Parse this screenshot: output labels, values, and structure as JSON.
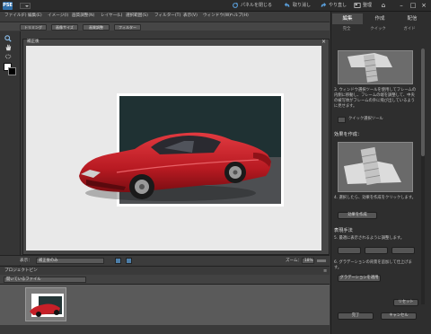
{
  "app": {
    "logo": "PSE"
  },
  "topbar": {
    "panel_toggle": "パネルを閉じる",
    "undo": "取り消し",
    "redo": "やり直し",
    "organizer": "整理"
  },
  "menu": [
    "ファイル(F)",
    "編集(E)",
    "イメージ(I)",
    "画質調整(N)",
    "レイヤー(L)",
    "選択範囲(S)",
    "フィルター(T)",
    "表示(V)",
    "ウィンドウ(W)",
    "ヘルプ(H)"
  ],
  "options": [
    "トリミング",
    "画像サイズ",
    "画質調整",
    "フィルター"
  ],
  "document": {
    "tab_label": "補正後",
    "close": "×"
  },
  "status": {
    "view_label": "表示：",
    "view_value": "補正後のみ",
    "zoom_label": "ズーム：",
    "zoom_value": "18%"
  },
  "bin": {
    "header": "プロジェクトビン",
    "dropdown": "開いているファイル"
  },
  "panel": {
    "tabs": [
      "編集",
      "作成",
      "配信"
    ],
    "subtabs": [
      "完全",
      "クイック",
      "ガイド"
    ],
    "step3_text": "3. ウィンドウ選択ツールを使用してフレームの内側に移動し、フレームの端を調整して、中央の被写体がフレームの外に飛び出しているように見せます。",
    "quick_tool": "クイック選択ツール",
    "effect_heading": "効果を作成：",
    "step4_text": "4. 選択したら、効果を作成をクリックします。",
    "create_effect_btn": "効果を作成",
    "finish_heading": "表現手法",
    "step5_text": "5. 最適に表示されるように調整します。",
    "style_buttons": [
      "",
      "",
      ""
    ],
    "step6_text": "6. グラデーションの背景を追加して仕上げます。",
    "gradient_btn": "グラデーションを適用",
    "reset_btn": "リセット",
    "done_btn": "完了",
    "cancel_btn": "キャンセル"
  },
  "colors": {
    "accent": "#2f6ea8",
    "car_red": "#c4222a"
  }
}
